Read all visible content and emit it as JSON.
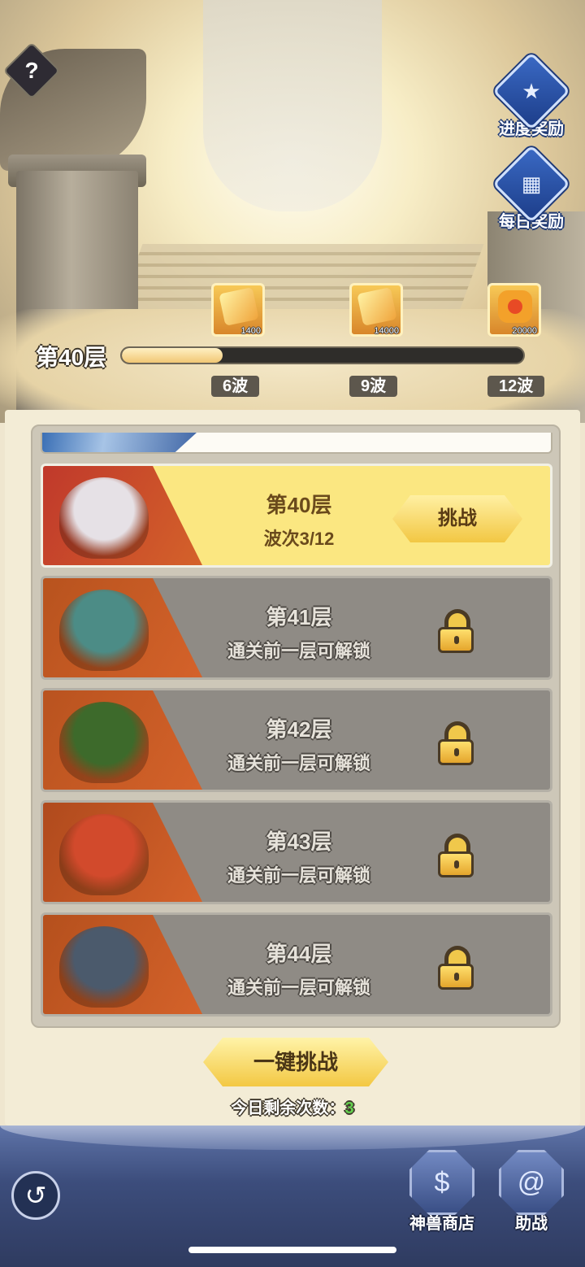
{
  "help": {
    "label": "?"
  },
  "side": {
    "progress_reward": "进度奖励",
    "daily_reward": "每日奖励"
  },
  "progress": {
    "current_floor": "第40层",
    "fraction": 0.25,
    "rewards": [
      {
        "amount": "1400",
        "icon": "scroll-icon"
      },
      {
        "amount": "14000",
        "icon": "scroll-icon"
      },
      {
        "amount": "20000",
        "icon": "coin-icon"
      }
    ],
    "waves": [
      "6波",
      "9波",
      "12波"
    ]
  },
  "floors": [
    {
      "title": "第40层",
      "sub": "波次3/12",
      "state": "active",
      "button": "挑战",
      "art": [
        "#c0392b",
        "#e6e1e6"
      ]
    },
    {
      "title": "第41层",
      "sub": "通关前一层可解锁",
      "state": "locked",
      "art": [
        "#b8531e",
        "#4c8c86"
      ]
    },
    {
      "title": "第42层",
      "sub": "通关前一层可解锁",
      "state": "locked",
      "art": [
        "#b9531f",
        "#3d6a2b"
      ]
    },
    {
      "title": "第43层",
      "sub": "通关前一层可解锁",
      "state": "locked",
      "art": [
        "#b04a1d",
        "#d24a2c"
      ]
    },
    {
      "title": "第44层",
      "sub": "通关前一层可解锁",
      "state": "locked",
      "art": [
        "#b5501d",
        "#4b5a6c"
      ]
    }
  ],
  "one_key": "一键挑战",
  "remaining": {
    "label": "今日剩余次数：",
    "count": "3"
  },
  "bottom": {
    "back_icon": "↺",
    "shop": "神兽商店",
    "assist": "助战"
  }
}
